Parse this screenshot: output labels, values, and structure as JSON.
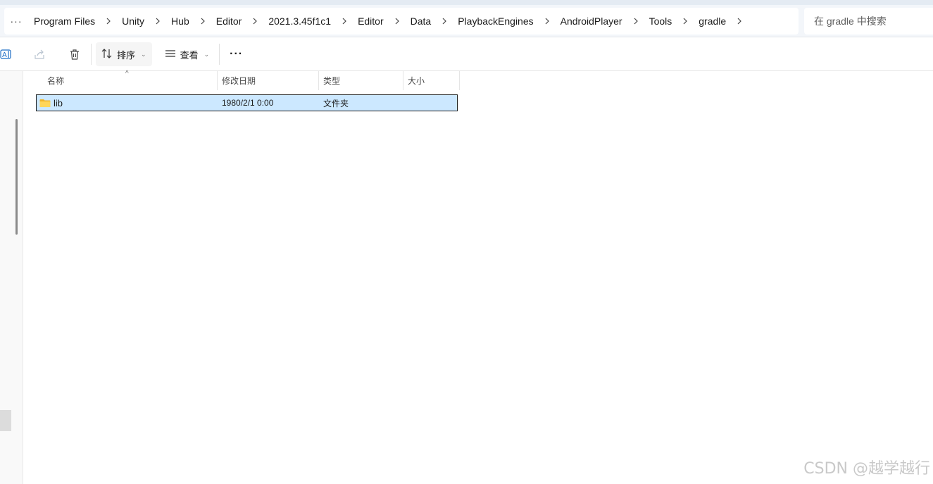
{
  "address_bar": {
    "overflow": "···",
    "crumbs": [
      "Program Files",
      "Unity",
      "Hub",
      "Editor",
      "2021.3.45f1c1",
      "Editor",
      "Data",
      "PlaybackEngines",
      "AndroidPlayer",
      "Tools",
      "gradle"
    ],
    "search_placeholder": "在 gradle 中搜索"
  },
  "toolbar": {
    "sort_label": "排序",
    "view_label": "查看",
    "more_label": "···"
  },
  "file_list": {
    "columns": [
      "名称",
      "修改日期",
      "类型",
      "大小"
    ],
    "rows": [
      {
        "name": "lib",
        "modified": "1980/2/1 0:00",
        "type": "文件夹",
        "size": ""
      }
    ]
  },
  "watermark": "CSDN @越学越行",
  "colors": {
    "selection": "#cce8ff",
    "folder": "#f4c343"
  }
}
